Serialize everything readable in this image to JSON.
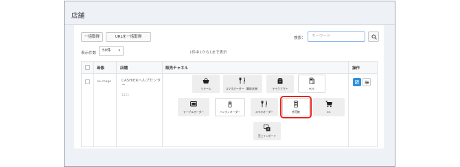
{
  "page": {
    "title": "店舗"
  },
  "toolbar": {
    "bulk_get_label": "一括取得",
    "url_bulk_get_label": "URLを一括取得",
    "search_label": "検索：",
    "search_placeholder": "キーワード"
  },
  "list": {
    "count_label": "表示件数",
    "count_value": "50件",
    "range_text": "1件中1から1まで表示"
  },
  "table": {
    "headers": {
      "image": "画像",
      "store": "店舗",
      "channels": "販売チャネル",
      "actions": "操作"
    },
    "rows": [
      {
        "image_text": "no image",
        "store_name": "CASHIERヘルプセンター",
        "store_code": "1111",
        "channels": [
          {
            "label": "リテール",
            "icon": "basket-icon",
            "active": true
          },
          {
            "label": "スマホオーダー（事前決済）",
            "icon": "utensils-icon",
            "active": true
          },
          {
            "label": "テイクアウト",
            "icon": "takeout-bag-icon",
            "active": true
          },
          {
            "label": "POS",
            "icon": "pos-terminal-icon",
            "active": false
          },
          {
            "label": "テーブルオーダー",
            "icon": "tablet-icon",
            "active": true
          },
          {
            "label": "ハンディオーダー",
            "icon": "handy-device-icon",
            "active": false
          },
          {
            "label": "スマホオーダー",
            "icon": "utensils-icon",
            "active": true
          },
          {
            "label": "券売機",
            "icon": "ticket-machine-icon",
            "active": false,
            "highlighted": true
          },
          {
            "label": "EC",
            "icon": "cart-icon",
            "active": true
          },
          {
            "label": "売上インポート",
            "icon": "sales-import-icon",
            "active": true
          }
        ]
      }
    ]
  },
  "colors": {
    "highlight": "#e8231b",
    "edit_button": "#2d8fd9",
    "search_border": "#8ab4ee"
  }
}
